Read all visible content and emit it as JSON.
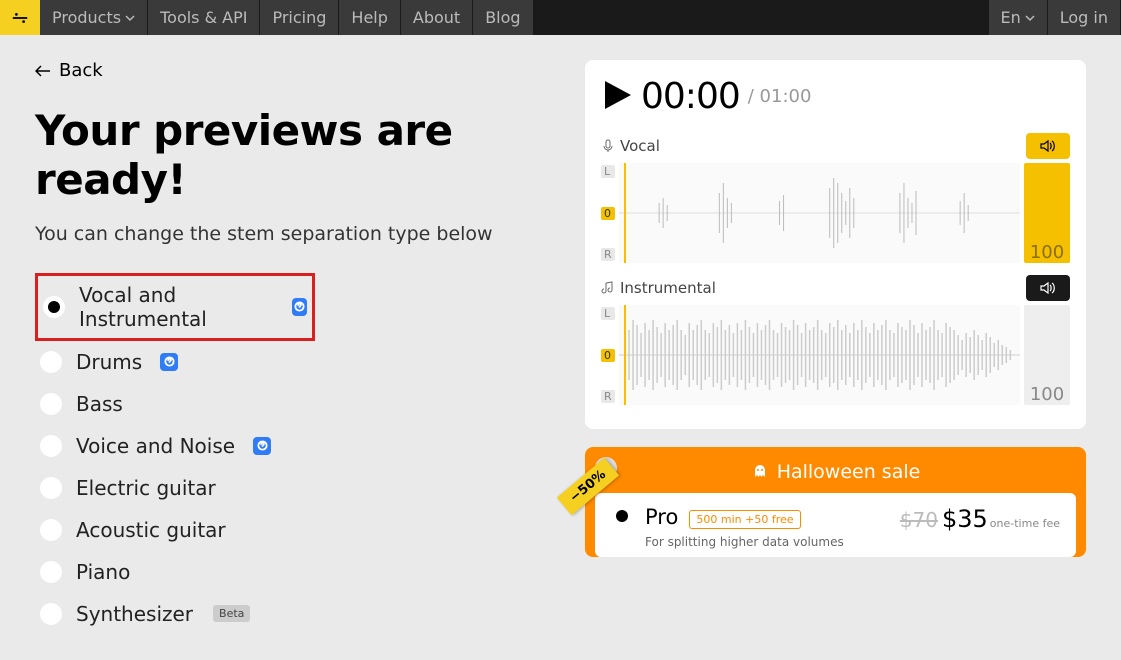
{
  "nav": {
    "products": "Products",
    "tools": "Tools & API",
    "pricing": "Pricing",
    "help": "Help",
    "about": "About",
    "blog": "Blog",
    "lang": "En",
    "login": "Log in"
  },
  "back": "Back",
  "title": "Your previews are ready!",
  "subtitle": "You can change the stem separation type below",
  "options": {
    "vocal_instrumental": "Vocal and Instrumental",
    "drums": "Drums",
    "bass": "Bass",
    "voice_noise": "Voice and Noise",
    "electric_guitar": "Electric guitar",
    "acoustic_guitar": "Acoustic guitar",
    "piano": "Piano",
    "synthesizer": "Synthesizer",
    "beta": "Beta"
  },
  "player": {
    "time": "00:00",
    "duration": "/ 01:00",
    "stems": {
      "vocal": {
        "label": "Vocal",
        "volume": "100"
      },
      "instrumental": {
        "label": "Instrumental",
        "volume": "100"
      }
    },
    "channels": {
      "l": "L",
      "z": "0",
      "r": "R"
    }
  },
  "promo": {
    "tag": "−50%",
    "title": "Halloween sale",
    "plan": {
      "name": "Pro",
      "badge": "500 min +50 free",
      "desc": "For splitting higher data volumes",
      "old_price": "$70",
      "new_price": "$35",
      "fee": "one-time fee"
    }
  }
}
